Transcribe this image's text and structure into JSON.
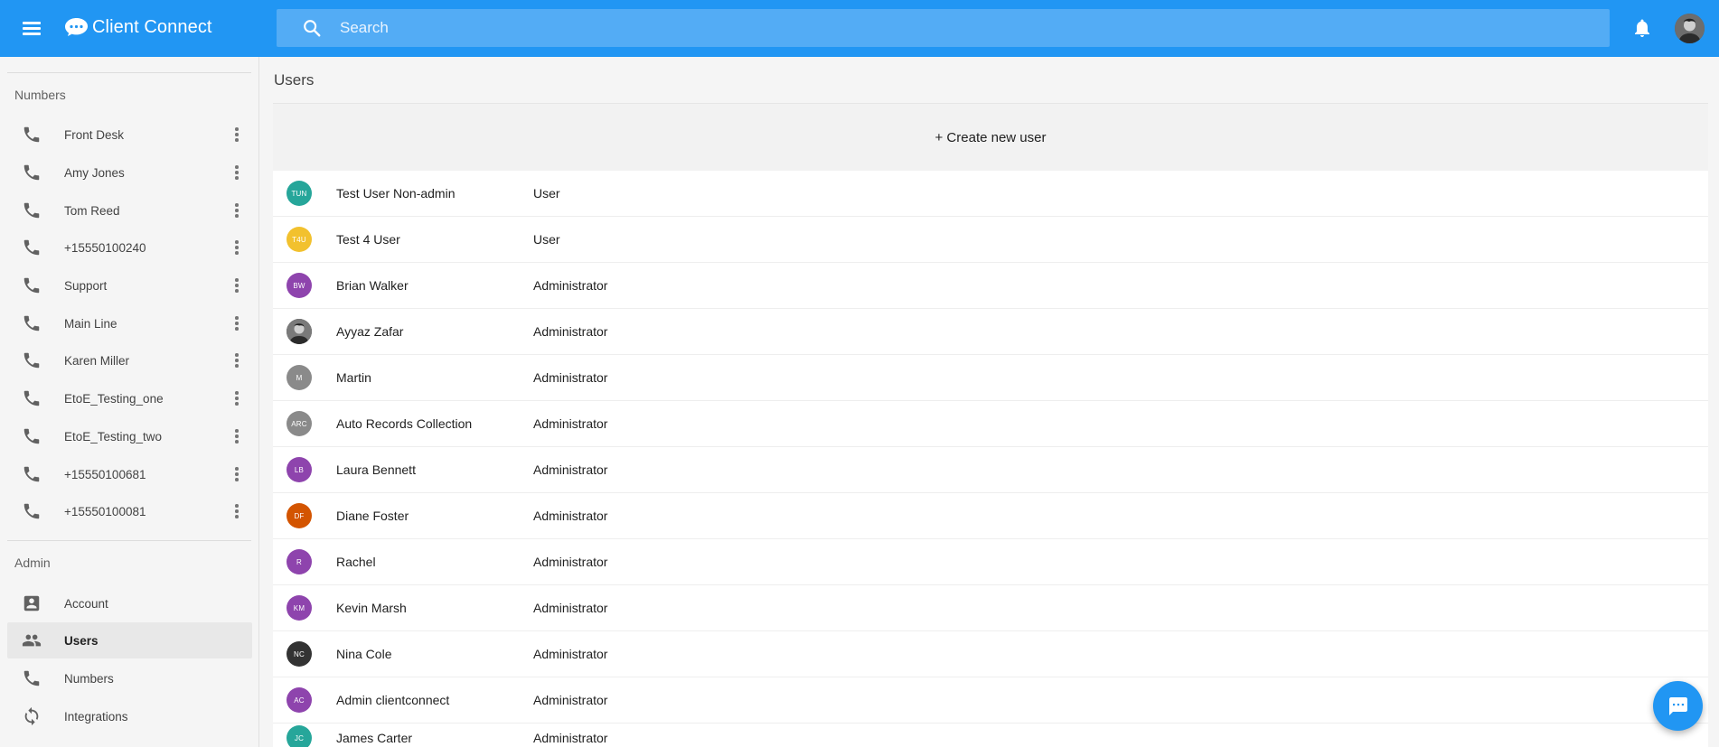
{
  "app": {
    "title": "Client Connect",
    "brand_color": "#2196f3"
  },
  "search": {
    "placeholder": "Search"
  },
  "sidebar": {
    "numbers_title": "Numbers",
    "numbers": [
      {
        "label": "Front Desk",
        "icon": "phone-icon"
      },
      {
        "label": "Amy Jones",
        "icon": "phone-icon"
      },
      {
        "label": "Tom Reed",
        "icon": "phone-icon"
      },
      {
        "label": "+15550100240",
        "icon": "phone-icon"
      },
      {
        "label": "Support",
        "icon": "phone-icon"
      },
      {
        "label": "Main Line",
        "icon": "phone-icon"
      },
      {
        "label": "Karen Miller",
        "icon": "phone-icon"
      },
      {
        "label": "EtoE_Testing_one",
        "icon": "phone-icon"
      },
      {
        "label": "EtoE_Testing_two",
        "icon": "phone-icon"
      },
      {
        "label": "+15550100681",
        "icon": "phone-icon"
      },
      {
        "label": "+15550100081",
        "icon": "phone-icon"
      }
    ],
    "admin_title": "Admin",
    "admin": [
      {
        "label": "Account",
        "icon": "account-box-icon"
      },
      {
        "label": "Users",
        "icon": "people-icon",
        "active": true
      },
      {
        "label": "Numbers",
        "icon": "phone-icon"
      },
      {
        "label": "Integrations",
        "icon": "sync-icon"
      }
    ]
  },
  "main": {
    "title": "Users",
    "create_label": "+ Create new user",
    "users": [
      {
        "initials": "TUN",
        "name": "Test User Non-admin",
        "role": "User",
        "color": "#26a69a"
      },
      {
        "initials": "T4U",
        "name": "Test 4 User",
        "role": "User",
        "color": "#f2c12e"
      },
      {
        "initials": "BW",
        "name": "Brian Walker",
        "role": "Administrator",
        "color": "#8e44ad"
      },
      {
        "initials": "",
        "name": "Ayyaz Zafar",
        "role": "Administrator",
        "color": "#3b3b3b",
        "photo": true
      },
      {
        "initials": "M",
        "name": "Martin",
        "role": "Administrator",
        "color": "#8a8a8a"
      },
      {
        "initials": "ARC",
        "name": "Auto Records Collection",
        "role": "Administrator",
        "color": "#8a8a8a"
      },
      {
        "initials": "LB",
        "name": "Laura Bennett",
        "role": "Administrator",
        "color": "#8e44ad"
      },
      {
        "initials": "DF",
        "name": "Diane Foster",
        "role": "Administrator",
        "color": "#d35400"
      },
      {
        "initials": "R",
        "name": "Rachel",
        "role": "Administrator",
        "color": "#8e44ad"
      },
      {
        "initials": "KM",
        "name": "Kevin Marsh",
        "role": "Administrator",
        "color": "#8e44ad"
      },
      {
        "initials": "NC",
        "name": "Nina Cole",
        "role": "Administrator",
        "color": "#333333"
      },
      {
        "initials": "AC",
        "name": "Admin clientconnect",
        "role": "Administrator",
        "color": "#8e44ad"
      },
      {
        "initials": "JC",
        "name": "James Carter",
        "role": "Administrator",
        "color": "#26a69a"
      }
    ]
  }
}
